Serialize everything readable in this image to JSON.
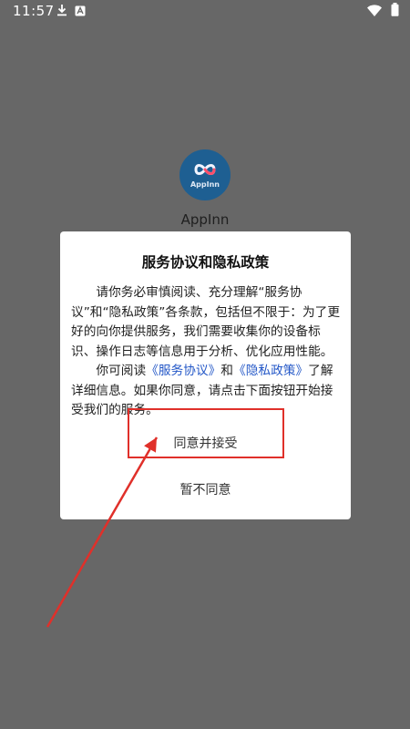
{
  "status_bar": {
    "time": "11:57",
    "icons": [
      "download-icon",
      "app-notification-icon",
      "wifi-icon",
      "battery-icon"
    ]
  },
  "app": {
    "logo_text": "AppInn",
    "name": "AppInn"
  },
  "dialog": {
    "title": "服务协议和隐私政策",
    "paragraph1": "请你务必审慎阅读、充分理解“服务协议”和“隐私政策”各条款，包括但不限于：为了更好的向你提供服务，我们需要收集你的设备标识、操作日志等信息用于分析、优化应用性能。",
    "p2_prefix": "你可阅读",
    "link_service": "《服务协议》",
    "p2_and": "和",
    "link_privacy": "《隐私政策》",
    "p2_suffix": "了解详细信息。如果你同意，请点击下面按钮开始接受我们的服务。",
    "accept_label": "同意并接受",
    "decline_label": "暂不同意"
  },
  "colors": {
    "overlay": "#676767",
    "link": "#2357c7",
    "annotation": "#e0302a"
  }
}
